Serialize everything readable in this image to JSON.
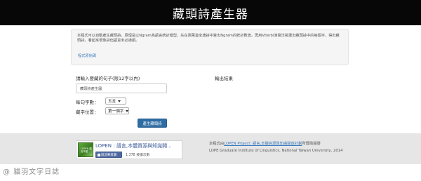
{
  "header": {
    "title": "藏頭詩產生器"
  },
  "intro": {
    "text": "本程式可以自動產生藏頭詩，原理是以Ngram為語言統計模型，先在兩萬首全唐詩中算出Ngram的統計數值，再用Viterbi演算法挑選出藏頭詩中的每個字，得出藏頭詩，看起來很像詩但語意未必通順。",
    "link": "程式原始碼"
  },
  "form": {
    "prompt_label": "請輸入要藏的句子(限12字以內)",
    "sentence_value": "藏頭詩產生器",
    "count_label": "每句字數：",
    "count_value": "五言",
    "position_label": "藏字位置：",
    "position_value": "第一個字",
    "generate_button": "產生藏頭詩"
  },
  "output": {
    "label": "輸出結果"
  },
  "footer": {
    "widget": {
      "title": "LOPEN : 語言,本體資源與知識開...",
      "thumb_text": "LOPEN 語言本體",
      "like_label": "說這專頁讚",
      "count": "1,378 按讚次數"
    },
    "credit_prefix": "本程式由",
    "credit_link": "LOPEN Project: 語言,本體資源與知識開放計劃",
    "credit_suffix": "所贊助開發",
    "credit_line2": "LOPE Graduate Institute of Linguistics, National Taiwan University, 2014"
  },
  "watermark": "@ 貓羽文字日誌"
}
